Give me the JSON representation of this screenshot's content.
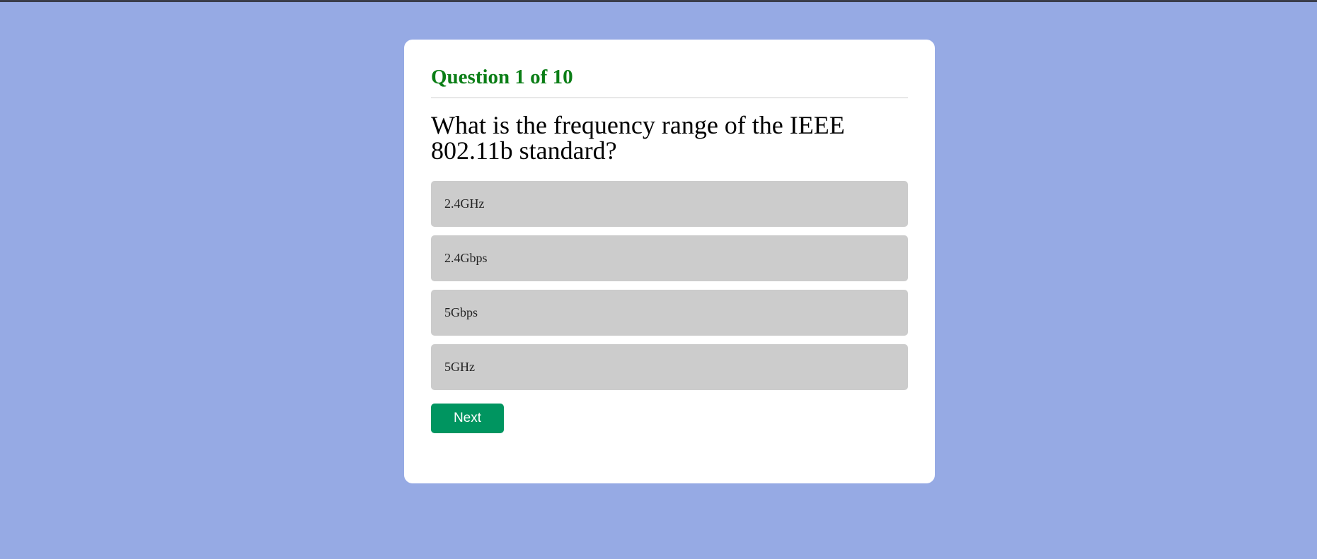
{
  "colors": {
    "page_background": "#96aae4",
    "card_background": "#ffffff",
    "counter_text": "#0b7e16",
    "answer_background": "#cccccc",
    "next_button_background": "#009560"
  },
  "quiz": {
    "counter": "Question 1 of 10",
    "question": "What is the frequency range of the IEEE 802.11b standard?",
    "answers": [
      {
        "label": "2.4GHz"
      },
      {
        "label": "2.4Gbps"
      },
      {
        "label": "5Gbps"
      },
      {
        "label": "5GHz"
      }
    ],
    "next_label": "Next"
  }
}
